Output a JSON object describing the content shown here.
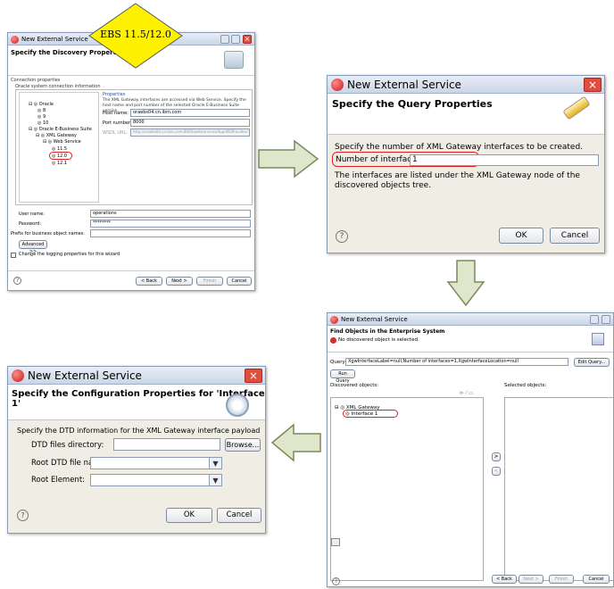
{
  "callout": {
    "text": "EBS 11.5/12.0"
  },
  "colors": {
    "arrow_fill": "#dfe6cc",
    "arrow_stroke": "#7a8a5a",
    "callout_fill": "#fff200",
    "highlight": "#e02020",
    "header_bg": "#ffffff"
  },
  "w1": {
    "title": "New External Service",
    "header": "Specify the Discovery Properties",
    "section": "Connection properties",
    "group": "Oracle system connection information",
    "tree": [
      "Oracle",
      "8",
      "9",
      "10",
      "Oracle E-Business Suite",
      "XML Gateway",
      "Web Service",
      "11.5",
      "12.0",
      "12.1"
    ],
    "props_title": "Properties",
    "props_desc": "The XML Gateway interfaces are accessed via Web Service. Specify the host name and port number of the selected Oracle E-Business Suite version.",
    "host_label": "Host name:",
    "host_value": "oraebs04.cn.ibm.com",
    "port_label": "Port number:",
    "port_value": "8000",
    "wsdl_label": "WSDL URL:",
    "wsdl_value": "http://oraebs04.cn.ibm.com:8000/webservices/AppsWSProvider/",
    "user_label": "User name:",
    "user_value": "operations",
    "pass_label": "Password:",
    "pass_value": "********",
    "prefix_label": "Prefix for business object names:",
    "advanced": "Advanced >>",
    "logging": "Change the logging properties for this wizard",
    "back": "< Back",
    "next": "Next >",
    "finish": "Finish",
    "cancel": "Cancel"
  },
  "w2": {
    "title": "New External Service",
    "header": "Specify the Query Properties",
    "desc": "Specify the number of XML Gateway interfaces to be created.",
    "num_label": "Number of interfaces:",
    "num_value": "1",
    "note": "The interfaces are listed under the XML Gateway node of the discovered objects tree.",
    "ok": "OK",
    "cancel": "Cancel"
  },
  "w3": {
    "title": "New External Service",
    "header": "Find Objects in the Enterprise System",
    "status": "No discovered object is selected.",
    "query_label": "Query:",
    "query_value": "XgwInterfaceLabel=null,Number of interfaces=1,XgwInterfaceLocation=null",
    "edit_query": "Edit Query...",
    "run_query": "Run Query",
    "discovered_label": "Discovered objects:",
    "selected_label": "Selected objects:",
    "tree_root": "XML Gateway",
    "tree_child": "Interface 1",
    "add": ">",
    "remove": "<",
    "back": "< Back",
    "next": "Next >",
    "finish": "Finish",
    "cancel": "Cancel"
  },
  "w4": {
    "title": "New External Service",
    "header": "Specify the Configuration Properties for 'Interface 1'",
    "desc": "Specify the DTD information for the XML Gateway interface payload",
    "dtd_dir_label": "DTD files directory:",
    "browse": "Browse...",
    "root_dtd_label": "Root DTD file name:",
    "root_elem_label": "Root Element:",
    "ok": "OK",
    "cancel": "Cancel"
  }
}
